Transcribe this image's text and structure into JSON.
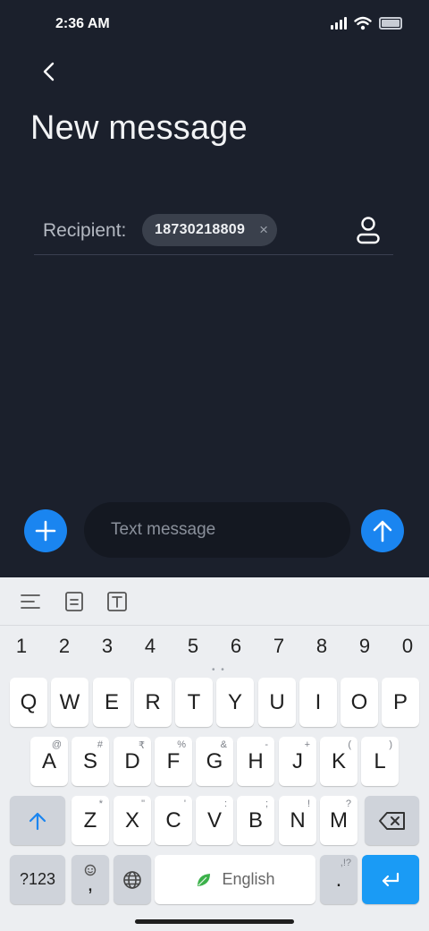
{
  "status_bar": {
    "time": "2:36 AM"
  },
  "header": {
    "title": "New message"
  },
  "recipient": {
    "label": "Recipient:",
    "chip_value": "18730218809",
    "chip_close": "×"
  },
  "compose": {
    "placeholder": "Text message"
  },
  "keyboard": {
    "numbers": [
      "1",
      "2",
      "3",
      "4",
      "5",
      "6",
      "7",
      "8",
      "9",
      "0"
    ],
    "row1": [
      "Q",
      "W",
      "E",
      "R",
      "T",
      "Y",
      "U",
      "I",
      "O",
      "P"
    ],
    "row2": [
      {
        "key": "A",
        "hint": "@"
      },
      {
        "key": "S",
        "hint": "#"
      },
      {
        "key": "D",
        "hint": "₹"
      },
      {
        "key": "F",
        "hint": "%"
      },
      {
        "key": "G",
        "hint": "&"
      },
      {
        "key": "H",
        "hint": "-"
      },
      {
        "key": "J",
        "hint": "+"
      },
      {
        "key": "K",
        "hint": "("
      },
      {
        "key": "L",
        "hint": ")"
      }
    ],
    "row3": [
      {
        "key": "Z",
        "hint": "*"
      },
      {
        "key": "X",
        "hint": "\""
      },
      {
        "key": "C",
        "hint": "'"
      },
      {
        "key": "V",
        "hint": ":"
      },
      {
        "key": "B",
        "hint": ";"
      },
      {
        "key": "N",
        "hint": "!"
      },
      {
        "key": "M",
        "hint": "?"
      }
    ],
    "symbols_label": "?123",
    "comma": ",",
    "space_label": "English",
    "period": ".",
    "period_hint": ",!?"
  },
  "colors": {
    "accent": "#1a85f0",
    "background": "#1b202c",
    "enter_key": "#1a9bf5"
  }
}
